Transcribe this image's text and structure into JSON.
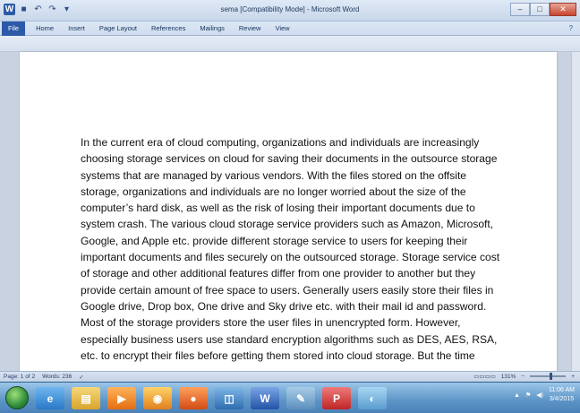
{
  "window": {
    "title": "sema [Compatibility Mode] - Microsoft Word",
    "minimize": "–",
    "maximize": "□",
    "close": "✕"
  },
  "ribbon": {
    "tabs": [
      "File",
      "Home",
      "Insert",
      "Page Layout",
      "References",
      "Mailings",
      "Review",
      "View"
    ],
    "help": "?"
  },
  "document": {
    "lines": [
      "In the current era of cloud computing, organizations and individuals are increasingly",
      "choosing storage services on cloud for saving their documents in the outsource storage",
      "systems that are managed by various vendors. With the files stored on the offsite",
      "storage, organizations and individuals are no longer worried about the size of the",
      "computer’s hard disk, as well as the risk of losing their important documents due to",
      "system crash. The various cloud storage service providers   such as Amazon, Microsoft,",
      "Google, and Apple etc. provide different storage service to users for keeping their",
      "important documents and files securely on the outsourced storage. Storage service cost",
      "of storage and other additional features differ from one provider to another but they",
      "provide certain amount of free space to users. Generally users easily store their files in",
      "Google drive, Drop box, One drive and Sky drive etc. with their mail id and password.",
      "Most of the storage providers store the user files in unencrypted form. However,",
      "especially business users use standard encryption algorithms such as DES, AES, RSA,",
      "etc. to encrypt their files before getting them stored into cloud storage. But the time"
    ]
  },
  "status": {
    "page": "Page: 1 of 2",
    "words": "Words: 236",
    "zoom": "131%"
  },
  "taskbar": {
    "time": "11:06 AM",
    "date": "3/4/2015"
  }
}
